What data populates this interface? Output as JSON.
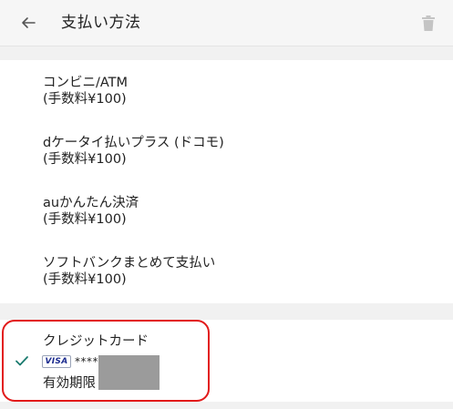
{
  "header": {
    "title": "支払い方法",
    "back_icon": "arrow-left-icon",
    "delete_icon": "trash-icon"
  },
  "payment_methods": [
    {
      "name": "コンビニ/ATM",
      "fee": "(手数料¥100)"
    },
    {
      "name": "dケータイ払いプラス (ドコモ)",
      "fee": "(手数料¥100)"
    },
    {
      "name": "auかんたん決済",
      "fee": "(手数料¥100)"
    },
    {
      "name": "ソフトバンクまとめて支払い",
      "fee": "(手数料¥100)"
    }
  ],
  "credit_card": {
    "name": "クレジットカード",
    "brand": "VISA",
    "masked_number": "****",
    "expiry_label": "有効期限",
    "selected": true,
    "check_icon": "check-icon"
  },
  "colors": {
    "highlight": "#e21a1a",
    "check": "#1a7a6e",
    "redaction": "#9b9b9b",
    "header_bg": "#f6f6f6",
    "page_bg": "#f1f1f1"
  }
}
